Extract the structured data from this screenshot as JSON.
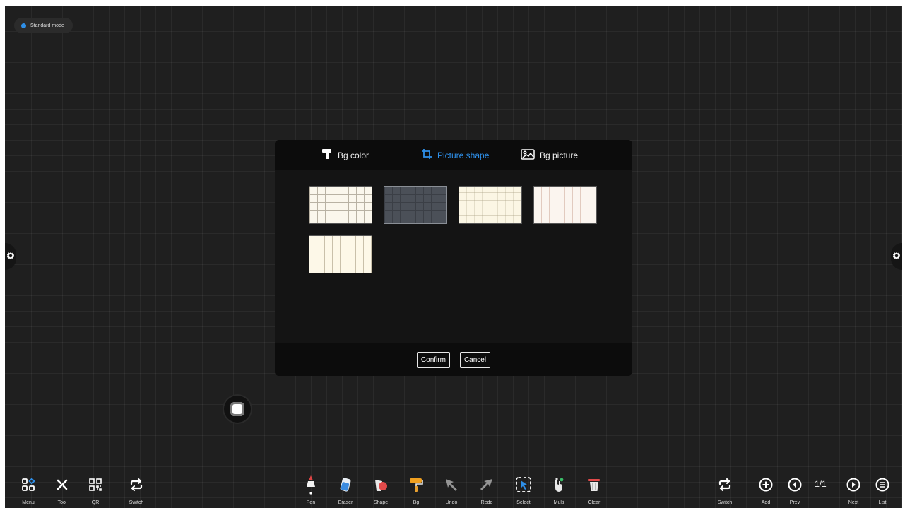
{
  "mode": {
    "label": "Standard mode",
    "dot_color": "#2e8fe8"
  },
  "side_tabs": {
    "left_icon": "gear-icon",
    "right_icon": "gear-icon"
  },
  "dialog": {
    "tabs": [
      {
        "label": "Bg color",
        "icon": "paint-roller-icon",
        "active": false
      },
      {
        "label": "Picture shape",
        "icon": "crop-icon",
        "active": true
      },
      {
        "label": "Bg picture",
        "icon": "image-icon",
        "active": false
      }
    ],
    "thumbnails": [
      "grid-light",
      "grid-dark",
      "dot-light",
      "stripe-pink",
      "stripe-cream"
    ],
    "selected_thumbnail": "grid-dark",
    "confirm_label": "Confirm",
    "cancel_label": "Cancel"
  },
  "toolbar": {
    "left": [
      {
        "label": "Menu",
        "icon": "menu-grid-icon"
      },
      {
        "label": "Tool",
        "icon": "tools-icon"
      },
      {
        "label": "QR",
        "icon": "qr-code-icon"
      },
      {
        "label": "Switch",
        "icon": "switch-icon"
      }
    ],
    "center": [
      {
        "label": "Pen",
        "icon": "pen-icon"
      },
      {
        "label": "Eraser",
        "icon": "eraser-icon"
      },
      {
        "label": "Shape",
        "icon": "shape-icon"
      },
      {
        "label": "Bg",
        "icon": "paint-roller-icon"
      },
      {
        "label": "Undo",
        "icon": "undo-icon"
      },
      {
        "label": "Redo",
        "icon": "redo-icon"
      },
      {
        "label": "Select",
        "icon": "select-icon"
      },
      {
        "label": "Multi",
        "icon": "multi-touch-icon"
      },
      {
        "label": "Clear",
        "icon": "trash-icon"
      }
    ],
    "right": [
      {
        "label": "Switch",
        "icon": "switch-icon"
      },
      {
        "label": "Add",
        "icon": "add-page-icon"
      },
      {
        "label": "Prev",
        "icon": "prev-page-icon"
      },
      {
        "label": "Next",
        "icon": "next-page-icon"
      },
      {
        "label": "List",
        "icon": "list-icon"
      }
    ],
    "page_indicator": "1/1"
  }
}
